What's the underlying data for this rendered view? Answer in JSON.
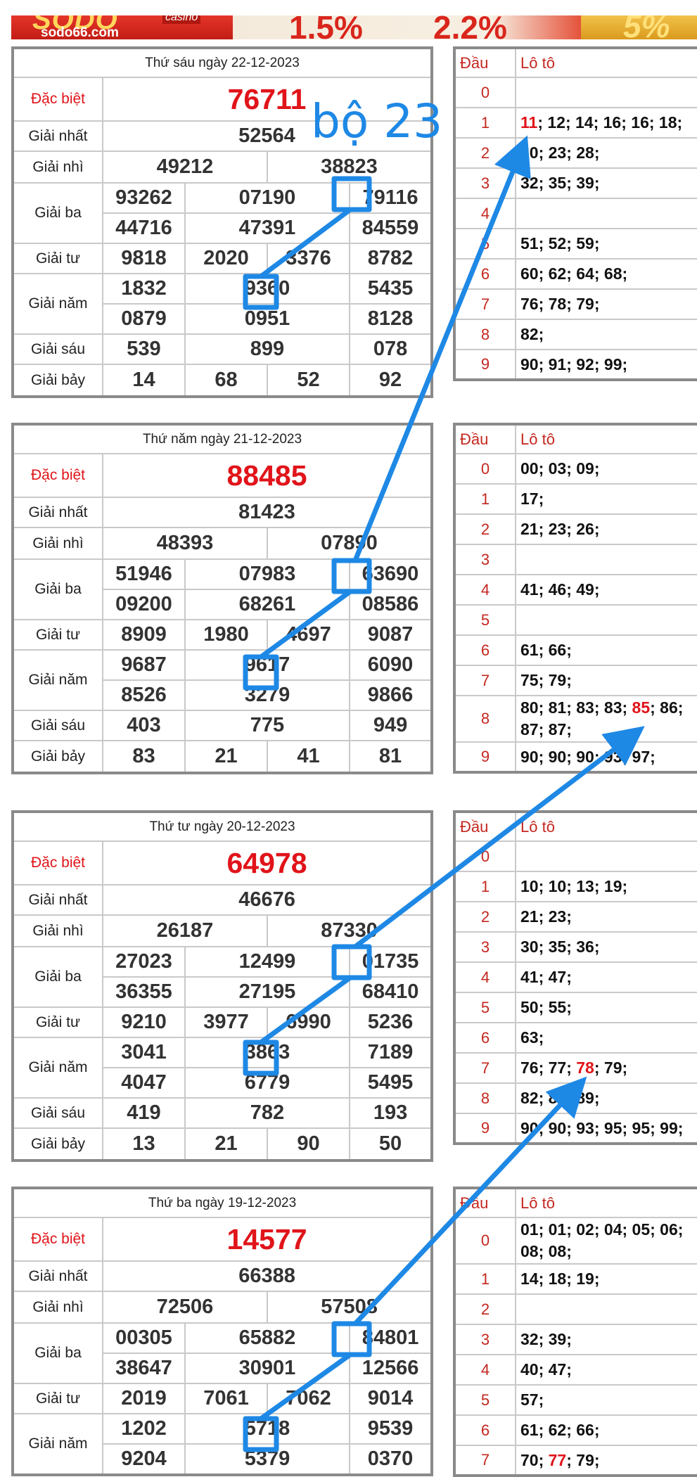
{
  "banner": {
    "logo_text": "SODO",
    "logo_sub": "casino",
    "site": "sodo66.com",
    "pct1": "1.5%",
    "pct2": "2.2%",
    "pct3": "5%"
  },
  "annotation": {
    "label": "bộ 23",
    "color": "#1e88e5"
  },
  "colors": {
    "red": "#e0141a",
    "loto_red": "#c4271f",
    "border": "#8a8a8a"
  },
  "labels": {
    "db": "Đặc biệt",
    "g1": "Giải nhất",
    "g2": "Giải nhì",
    "g3": "Giải ba",
    "g4": "Giải tư",
    "g5": "Giải năm",
    "g6": "Giải sáu",
    "g7": "Giải bảy",
    "dau": "Đầu",
    "loto": "Lô tô"
  },
  "days": [
    {
      "header": "Thứ sáu ngày 22-12-2023",
      "db": "76711",
      "g1": "52564",
      "g2": [
        "49212",
        "38823"
      ],
      "g3": [
        "93262",
        "07190",
        "79116",
        "44716",
        "47391",
        "84559"
      ],
      "g4": [
        "9818",
        "2020",
        "3376",
        "8782"
      ],
      "g5": [
        "1832",
        "9360",
        "5435",
        "0879",
        "0951",
        "8128"
      ],
      "g6": [
        "539",
        "899",
        "078"
      ],
      "g7": [
        "14",
        "68",
        "52",
        "92"
      ],
      "loto": [
        {
          "dau": "0",
          "val": ""
        },
        {
          "dau": "1",
          "hit": "11",
          "val": "; 12; 14; 16; 16; 18;"
        },
        {
          "dau": "2",
          "val": "20; 23; 28;"
        },
        {
          "dau": "3",
          "val": "32; 35; 39;"
        },
        {
          "dau": "4",
          "val": ""
        },
        {
          "dau": "5",
          "val": "51; 52; 59;"
        },
        {
          "dau": "6",
          "val": "60; 62; 64; 68;"
        },
        {
          "dau": "7",
          "val": "76; 78; 79;"
        },
        {
          "dau": "8",
          "val": "82;"
        },
        {
          "dau": "9",
          "val": "90; 91; 92; 99;"
        }
      ]
    },
    {
      "header": "Thứ năm ngày 21-12-2023",
      "db": "88485",
      "g1": "81423",
      "g2": [
        "48393",
        "07890"
      ],
      "g3": [
        "51946",
        "07983",
        "63690",
        "09200",
        "68261",
        "08586"
      ],
      "g4": [
        "8909",
        "1980",
        "4697",
        "9087"
      ],
      "g5": [
        "9687",
        "9617",
        "6090",
        "8526",
        "3279",
        "9866"
      ],
      "g6": [
        "403",
        "775",
        "949"
      ],
      "g7": [
        "83",
        "21",
        "41",
        "81"
      ],
      "loto": [
        {
          "dau": "0",
          "val": "00; 03; 09;"
        },
        {
          "dau": "1",
          "val": "17;"
        },
        {
          "dau": "2",
          "val": "21; 23; 26;"
        },
        {
          "dau": "3",
          "val": ""
        },
        {
          "dau": "4",
          "val": "41; 46; 49;"
        },
        {
          "dau": "5",
          "val": ""
        },
        {
          "dau": "6",
          "val": "61; 66;"
        },
        {
          "dau": "7",
          "val": "75; 79;"
        },
        {
          "dau": "8",
          "pre": "80; 81; 83; 83; ",
          "hit": "85",
          "val": "; 86; 87; 87;"
        },
        {
          "dau": "9",
          "val": "90; 90; 90; 93; 97;"
        }
      ]
    },
    {
      "header": "Thứ tư ngày 20-12-2023",
      "db": "64978",
      "g1": "46676",
      "g2": [
        "26187",
        "87330"
      ],
      "g3": [
        "27023",
        "12499",
        "01735",
        "36355",
        "27195",
        "68410"
      ],
      "g4": [
        "9210",
        "3977",
        "6990",
        "5236"
      ],
      "g5": [
        "3041",
        "3863",
        "7189",
        "4047",
        "6779",
        "5495"
      ],
      "g6": [
        "419",
        "782",
        "193"
      ],
      "g7": [
        "13",
        "21",
        "90",
        "50"
      ],
      "loto": [
        {
          "dau": "0",
          "val": ""
        },
        {
          "dau": "1",
          "val": "10; 10; 13; 19;"
        },
        {
          "dau": "2",
          "val": "21; 23;"
        },
        {
          "dau": "3",
          "val": "30; 35; 36;"
        },
        {
          "dau": "4",
          "val": "41; 47;"
        },
        {
          "dau": "5",
          "val": "50; 55;"
        },
        {
          "dau": "6",
          "val": "63;"
        },
        {
          "dau": "7",
          "pre": "76; 77; ",
          "hit": "78",
          "val": "; 79;"
        },
        {
          "dau": "8",
          "val": "82; 87; 89;"
        },
        {
          "dau": "9",
          "val": "90; 90; 93; 95; 95; 99;"
        }
      ]
    },
    {
      "header": "Thứ ba ngày 19-12-2023",
      "db": "14577",
      "g1": "66388",
      "g2": [
        "72506",
        "57508"
      ],
      "g3": [
        "00305",
        "65882",
        "84801",
        "38647",
        "30901",
        "12566"
      ],
      "g4": [
        "2019",
        "7061",
        "7062",
        "9014"
      ],
      "g5": [
        "1202",
        "5718",
        "9539",
        "9204",
        "5379",
        "0370"
      ],
      "g6": [],
      "g7": [],
      "loto": [
        {
          "dau": "0",
          "val": "01; 01; 02; 04; 05; 06; 08; 08;"
        },
        {
          "dau": "1",
          "val": "14; 18; 19;"
        },
        {
          "dau": "2",
          "val": ""
        },
        {
          "dau": "3",
          "val": "32; 39;"
        },
        {
          "dau": "4",
          "val": "40; 47;"
        },
        {
          "dau": "5",
          "val": "57;"
        },
        {
          "dau": "6",
          "val": "61; 62; 66;"
        },
        {
          "dau": "7",
          "pre": "70; ",
          "hit": "77",
          "val": "; 79;"
        }
      ]
    }
  ]
}
